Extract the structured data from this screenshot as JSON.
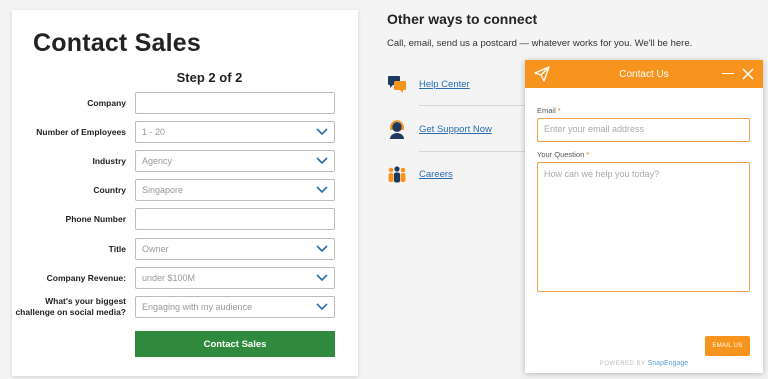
{
  "form": {
    "title": "Contact Sales",
    "step": "Step 2 of 2",
    "fields": [
      {
        "label": "Company",
        "value": "",
        "type": "text"
      },
      {
        "label": "Number of Employees",
        "value": "1 - 20",
        "type": "select"
      },
      {
        "label": "Industry",
        "value": "Agency",
        "type": "select"
      },
      {
        "label": "Country",
        "value": "Singapore",
        "type": "select"
      },
      {
        "label": "Phone Number",
        "value": "",
        "type": "text"
      },
      {
        "label": "Title",
        "value": "Owner",
        "type": "select"
      },
      {
        "label": "Company Revenue:",
        "value": "under $100M",
        "type": "select"
      },
      {
        "label": "What's your biggest challenge on social media?",
        "value": "Engaging with my audience",
        "type": "select"
      }
    ],
    "submit_label": "Contact Sales"
  },
  "other": {
    "title": "Other ways to connect",
    "subtitle": "Call, email, send us a postcard — whatever works for you. We'll be here.",
    "links": [
      {
        "label": "Help Center",
        "icon": "chat-bubbles-icon"
      },
      {
        "label": "Get Support Now",
        "icon": "support-agent-icon"
      },
      {
        "label": "Careers",
        "icon": "team-people-icon"
      }
    ]
  },
  "widget": {
    "title": "Contact Us",
    "email_label": "Email",
    "email_placeholder": "Enter your email address",
    "question_label": "Your Question",
    "question_placeholder": "How can we help you today?",
    "required_mark": "*",
    "send_label": "EMAIL US",
    "powered_by": "POWERED BY",
    "brand": "SnapEngage"
  },
  "colors": {
    "accent_orange": "#f7941d",
    "submit_green": "#2f8a3e",
    "link_blue": "#2a6db0",
    "chevron_blue": "#2a6db0"
  }
}
